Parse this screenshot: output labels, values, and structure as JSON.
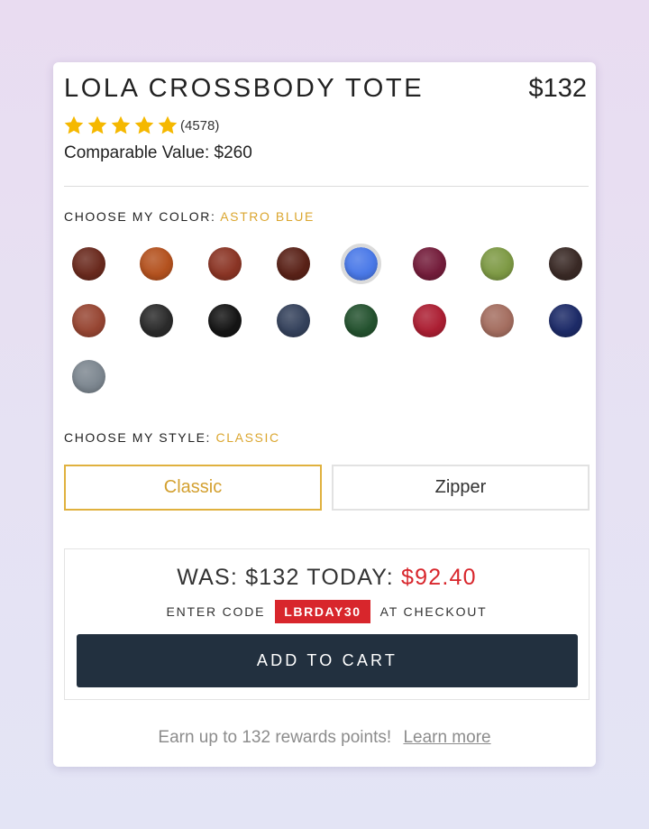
{
  "product": {
    "title": "LOLA CROSSBODY TOTE",
    "price": "$132",
    "review_count": "(4578)",
    "rating_stars": 5,
    "comparable_value": "Comparable Value: $260"
  },
  "color_section": {
    "label": "CHOOSE MY COLOR:",
    "selected": "ASTRO BLUE",
    "swatches": [
      {
        "color": "#6a2a1e"
      },
      {
        "color": "#b4521f"
      },
      {
        "color": "#8b3525"
      },
      {
        "color": "#5a2218"
      },
      {
        "color": "#4a79e8",
        "selected": true
      },
      {
        "color": "#741d3b"
      },
      {
        "color": "#7e9a45"
      },
      {
        "color": "#3a2a26"
      },
      {
        "color": "#974633"
      },
      {
        "color": "#2b2b2b"
      },
      {
        "color": "#151515"
      },
      {
        "color": "#35425c"
      },
      {
        "color": "#24522f"
      },
      {
        "color": "#ac1f33"
      },
      {
        "color": "#a46e60"
      },
      {
        "color": "#1d2b68"
      },
      {
        "color": "#7d8790"
      }
    ]
  },
  "style_section": {
    "label": "CHOOSE MY STYLE:",
    "selected": "CLASSIC",
    "options": [
      "Classic",
      "Zipper"
    ]
  },
  "promo": {
    "was_text": "WAS: $132 TODAY:",
    "today_price": "$92.40",
    "enter_code": "ENTER CODE",
    "code": "LBRDAY30",
    "at_checkout": "AT CHECKOUT",
    "cart_button": "ADD TO CART"
  },
  "rewards": {
    "text": "Earn up to 132 rewards points!",
    "link": "Learn more"
  },
  "colors": {
    "accent": "#dba62f",
    "sale_red": "#d8262c",
    "cart_button_bg": "#22303f",
    "star": "#f5b800"
  }
}
